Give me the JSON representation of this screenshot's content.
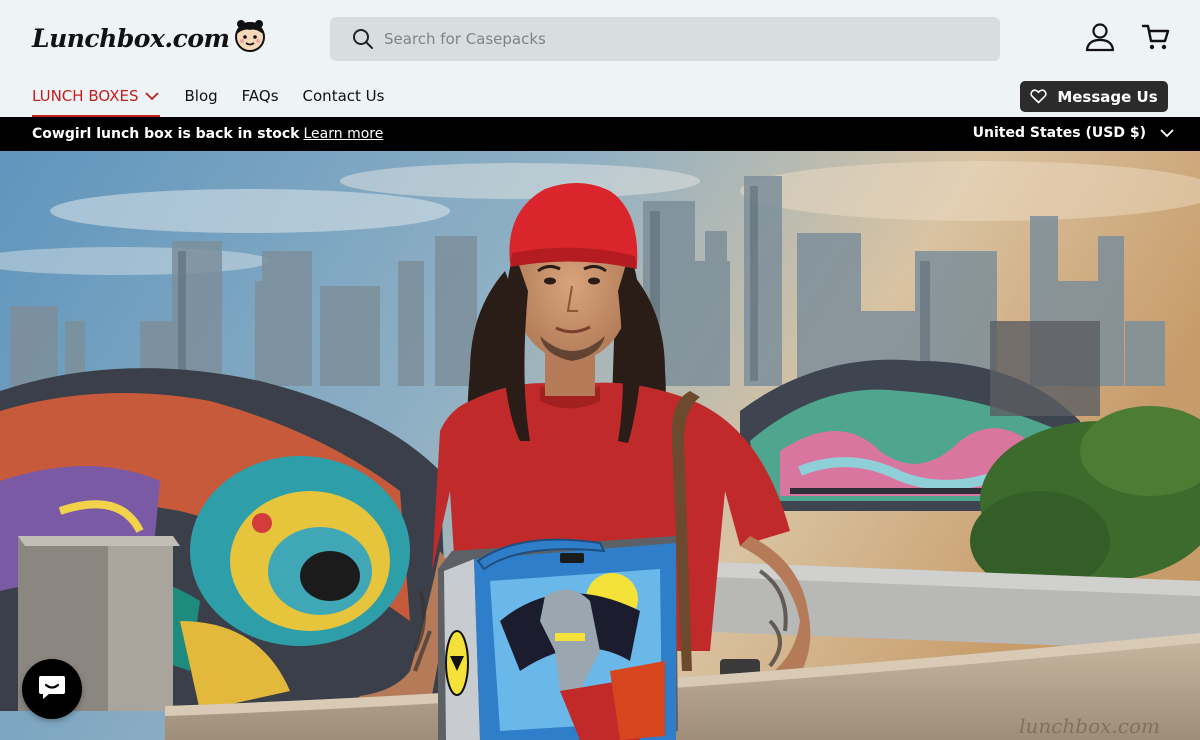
{
  "header": {
    "logo_text": "Lunchbox.com",
    "search": {
      "placeholder": "Search for Casepacks",
      "value": ""
    },
    "account_icon": "account-icon",
    "cart_icon": "cart-icon"
  },
  "nav": {
    "items": [
      {
        "label": "LUNCH BOXES",
        "active": true,
        "has_dropdown": true
      },
      {
        "label": "Blog"
      },
      {
        "label": "FAQs"
      },
      {
        "label": "Contact Us"
      }
    ],
    "message_button": "Message Us"
  },
  "announcement": {
    "text": "Cowgirl lunch box is back in stock",
    "link": "Learn more",
    "country": "United States (USD $)"
  },
  "hero": {
    "image_subject": "man holding lunch box in front of graffiti skyline",
    "watermark_text": "lunchbox.com"
  },
  "colors": {
    "accent_red": "#c41e1e",
    "header_bg": "#eef3f5",
    "search_bg": "#d8dee0",
    "dark_button": "#2b2b2b",
    "announcement_bg": "#000000"
  },
  "icons": [
    "search-icon",
    "account-icon",
    "cart-icon",
    "chevron-down-icon",
    "heart-icon",
    "chat-icon",
    "logo-face-icon"
  ]
}
